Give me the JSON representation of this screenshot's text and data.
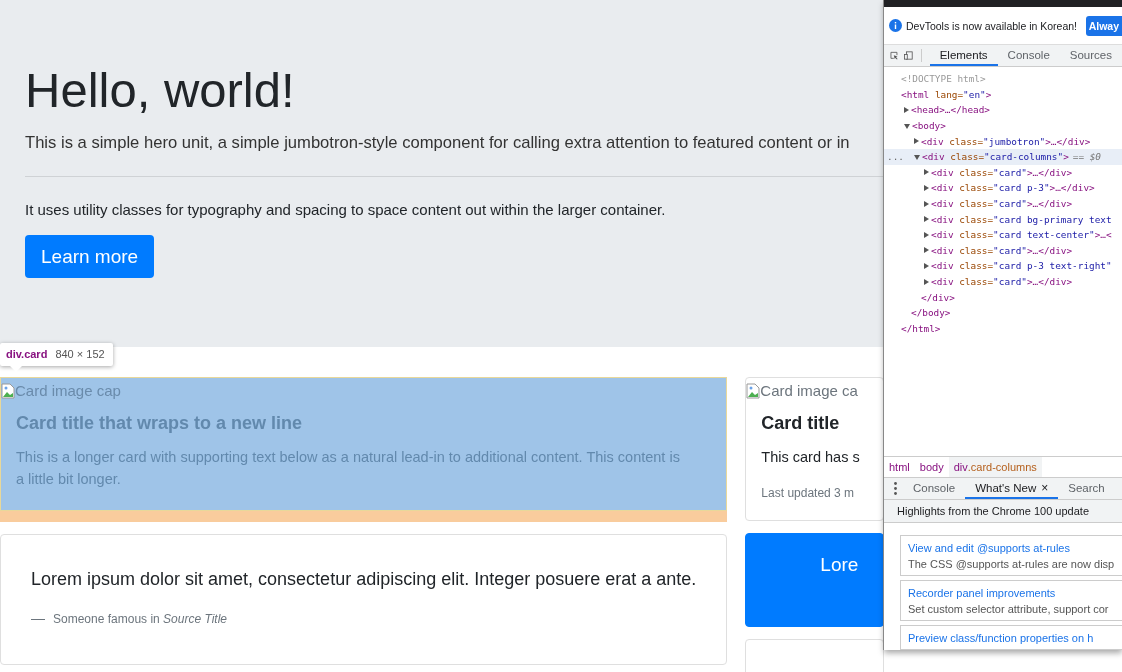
{
  "page": {
    "jumbotron": {
      "heading": "Hello, world!",
      "lead": "This is a simple hero unit, a simple jumbotron-style component for calling extra attention to featured content or in",
      "text": "It uses utility classes for typography and spacing to space content out within the larger container.",
      "button": "Learn more"
    },
    "columns": [
      [
        {
          "kind": "image",
          "highlighted": true,
          "image_alt": "Card image cap",
          "title": "Card title that wraps to a new line",
          "text": "This is a longer card with supporting text below as a natural lead-in to additional content. This content is a little bit longer."
        },
        {
          "kind": "quote",
          "highlighted": false,
          "quote": "Lorem ipsum dolor sit amet, consectetur adipiscing elit. Integer posuere erat a ante.",
          "footer": "Someone famous in *Source Title*"
        }
      ],
      [
        {
          "kind": "image",
          "highlighted": false,
          "image_alt": "Card image ca",
          "title": "Card title",
          "text": "This card has s",
          "note": "Last updated 3 m"
        },
        {
          "kind": "primary",
          "highlighted": false,
          "quote": "Lore"
        },
        {
          "kind": "blank",
          "highlighted": false
        }
      ]
    ]
  },
  "inspect_tooltip": {
    "selector": "div.card",
    "size": "840 × 152"
  },
  "devtools": {
    "infobar": {
      "message": "DevTools is now available in Korean!",
      "button": "Alway"
    },
    "tabs": [
      {
        "label": "Elements",
        "selected": true
      },
      {
        "label": "Console",
        "selected": false
      },
      {
        "label": "Sources",
        "selected": false
      }
    ],
    "tree": [
      {
        "kind": "doctype",
        "text": "<!DOCTYPE html>",
        "selected": false
      },
      {
        "kind": "element",
        "text": "<html lang=\"en\">",
        "selected": false,
        "closing": "</html>",
        "children": [
          {
            "kind": "element",
            "text": "<head>…</head>",
            "expanded": false,
            "selected": false
          },
          {
            "kind": "element",
            "text": "<body>",
            "expanded": true,
            "selected": false,
            "closing": "</body>",
            "children": [
              {
                "kind": "element",
                "text": "<div class=\"jumbotron\">…</div>",
                "expanded": false,
                "selected": false
              },
              {
                "kind": "element",
                "text": "<div class=\"card-columns\">",
                "expanded": true,
                "selected": true,
                "gutter": "...",
                "suffix": "== $0",
                "closing": "</div>",
                "children": [
                  {
                    "kind": "element",
                    "text": "<div class=\"card\">…</div>",
                    "expanded": false,
                    "selected": false
                  },
                  {
                    "kind": "element",
                    "text": "<div class=\"card p-3\">…</div>",
                    "expanded": false,
                    "selected": false
                  },
                  {
                    "kind": "element",
                    "text": "<div class=\"card\">…</div>",
                    "expanded": false,
                    "selected": false
                  },
                  {
                    "kind": "element",
                    "text": "<div class=\"card bg-primary text",
                    "expanded": false,
                    "selected": false
                  },
                  {
                    "kind": "element",
                    "text": "<div class=\"card text-center\">…<",
                    "expanded": false,
                    "selected": false
                  },
                  {
                    "kind": "element",
                    "text": "<div class=\"card\">…</div>",
                    "expanded": false,
                    "selected": false
                  },
                  {
                    "kind": "element",
                    "text": "<div class=\"card p-3 text-right\"",
                    "expanded": false,
                    "selected": false
                  },
                  {
                    "kind": "element",
                    "text": "<div class=\"card\">…</div>",
                    "expanded": false,
                    "selected": false
                  }
                ]
              }
            ]
          }
        ]
      }
    ],
    "breadcrumbs": [
      {
        "tag": "html",
        "selected": false
      },
      {
        "tag": "body",
        "selected": false
      },
      {
        "tag": "div",
        "cls": ".card-columns",
        "selected": true
      }
    ],
    "drawer_tabs": [
      {
        "label": "Console",
        "selected": false
      },
      {
        "label": "What's New",
        "close": "×",
        "selected": true
      },
      {
        "label": "Search",
        "selected": false
      }
    ],
    "whats_new": {
      "header": "Highlights from the Chrome 100 update",
      "items": [
        {
          "title": "View and edit @supports at-rules",
          "text": "The CSS @supports at-rules are now disp"
        },
        {
          "title": "Recorder panel improvements",
          "text": "Set custom selector attribute, support cor"
        },
        {
          "title": "Preview class/function properties on h"
        }
      ]
    }
  }
}
